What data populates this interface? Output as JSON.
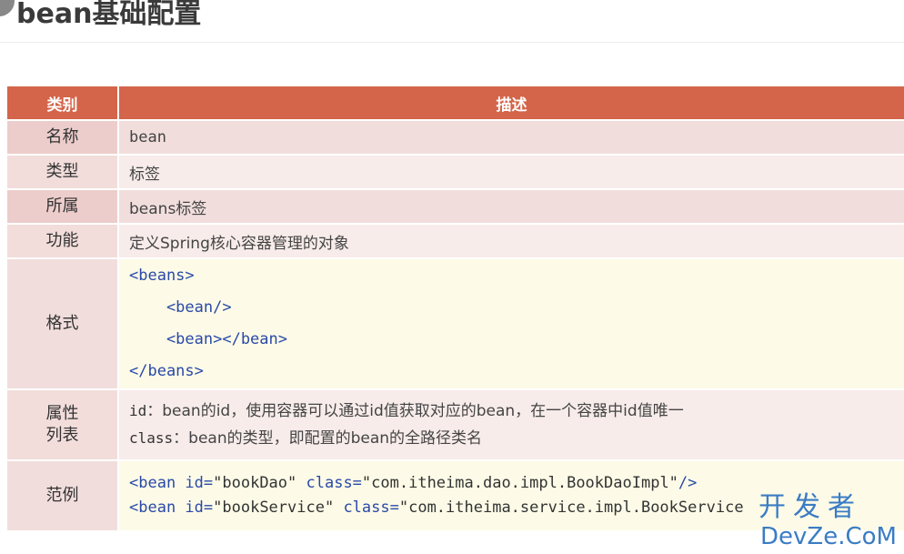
{
  "page": {
    "title": "bean基础配置"
  },
  "table": {
    "headers": {
      "category": "类别",
      "description": "描述"
    },
    "rows": {
      "name": {
        "category": "名称",
        "value": "bean"
      },
      "type": {
        "category": "类型",
        "value": "标签"
      },
      "belongs": {
        "category": "所属",
        "value": "beans标签"
      },
      "function": {
        "category": "功能",
        "value": "定义Spring核心容器管理的对象"
      },
      "format": {
        "category": "格式",
        "lines": [
          "<beans>",
          "    <bean/>",
          "    <bean></bean>",
          "</beans>"
        ]
      },
      "attributes": {
        "category_line1": "属性",
        "category_line2": "列表",
        "id_name": "id",
        "id_desc": "：bean的id，使用容器可以通过id值获取对应的bean，在一个容器中id值唯一",
        "class_name": "class",
        "class_desc": "：bean的类型，即配置的bean的全路径类名"
      },
      "example": {
        "category": "范例",
        "line1": {
          "open": "<bean",
          "id_attr": " id=",
          "id_value": "\"bookDao\"",
          "class_attr": " class=",
          "class_value": "\"com.itheima.dao.impl.BookDaoImpl\"",
          "close": "/>"
        },
        "line2": {
          "open": "<bean",
          "id_attr": " id=",
          "id_value": "\"bookService\"",
          "class_attr": " class=",
          "class_value": "\"com.itheima.service.impl.BookService"
        }
      }
    }
  },
  "watermark": {
    "cn": "开发者",
    "en": "DevZe.CoM"
  },
  "colors": {
    "header": "#d4654a",
    "code_keyword": "#2a49a8",
    "watermark": "#3b7cc4"
  }
}
